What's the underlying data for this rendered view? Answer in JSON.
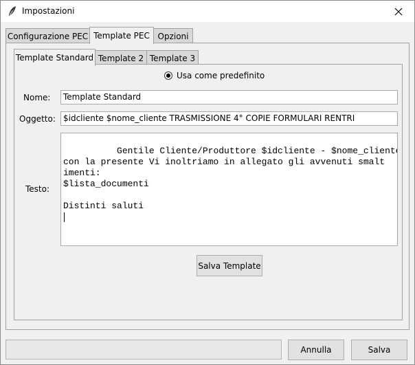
{
  "window": {
    "title": "Impostazioni"
  },
  "outer_tabs": [
    {
      "label": "Configurazione PEC"
    },
    {
      "label": "Template PEC"
    },
    {
      "label": "Opzioni"
    }
  ],
  "inner_tabs": [
    {
      "label": "Template Standard"
    },
    {
      "label": "Template 2"
    },
    {
      "label": "Template 3"
    }
  ],
  "form": {
    "default_radio_label": "Usa come predefinito",
    "name_label": "Nome:",
    "name_value": "Template Standard",
    "subject_label": "Oggetto:",
    "subject_value": "$idcliente $nome_cliente TRASMISSIONE 4° COPIE FORMULARI RENTRI",
    "body_label": "Testo:",
    "body_value": "Gentile Cliente/Produttore $idcliente - $nome_cliente,\ncon la presente Vi inoltriamo in allegato gli avvenuti smalt\nimenti:\n$lista_documenti\n\nDistinti saluti\n",
    "save_template_label": "Salva Template"
  },
  "footer": {
    "cancel_label": "Annulla",
    "save_label": "Salva"
  }
}
